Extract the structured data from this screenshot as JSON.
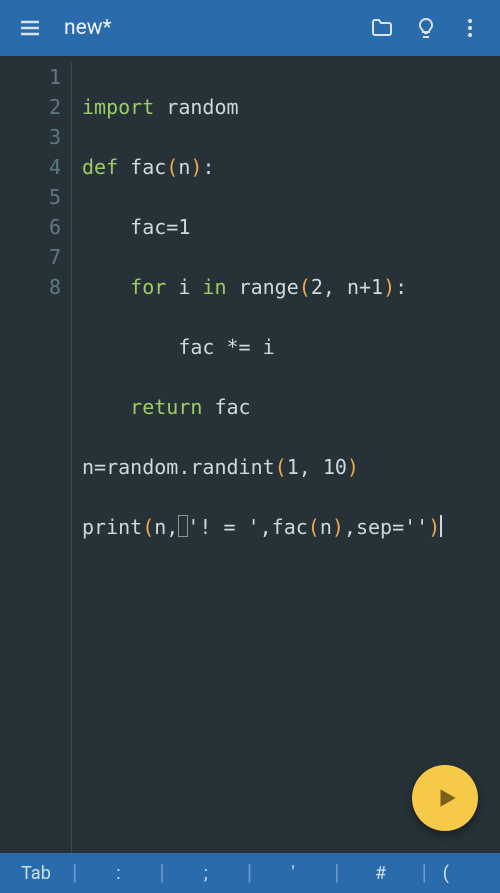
{
  "header": {
    "title": "new*"
  },
  "gutter": {
    "lines": [
      "1",
      "2",
      "3",
      "4",
      "5",
      "6",
      "7",
      "8"
    ]
  },
  "code": {
    "l1": {
      "kw": "import",
      "rest": " random"
    },
    "l2": {
      "kw": "def",
      "fn": " fac",
      "p1": "(",
      "arg": "n",
      "p2": ")",
      "colon": ":"
    },
    "l3": {
      "indent": "    ",
      "text": "fac=1"
    },
    "l4": {
      "indent": "    ",
      "kw1": "for",
      "mid": " i ",
      "kw2": "in",
      "sp": " ",
      "fn": "range",
      "p1": "(",
      "args": "2, n+1",
      "p2": ")",
      "colon": ":"
    },
    "l5": {
      "indent": "        ",
      "text": "fac *= i"
    },
    "l6": {
      "indent": "    ",
      "kw": "return",
      "rest": " fac"
    },
    "l7": {
      "pre": "n=random.randint",
      "p1": "(",
      "args": "1, 10",
      "p2": ")"
    },
    "l8": {
      "pre": "print",
      "p1": "(",
      "a1": "n,",
      "s1": "'! = '",
      "a2": ",fac",
      "p2": "(",
      "a3": "n",
      "p3": ")",
      "a4": ",sep=",
      "s2": "''",
      "p4": ")"
    }
  },
  "bottombar": {
    "tab": "Tab",
    "colon": ":",
    "semicolon": ";",
    "quote": "'",
    "hash": "#",
    "paren": "("
  }
}
